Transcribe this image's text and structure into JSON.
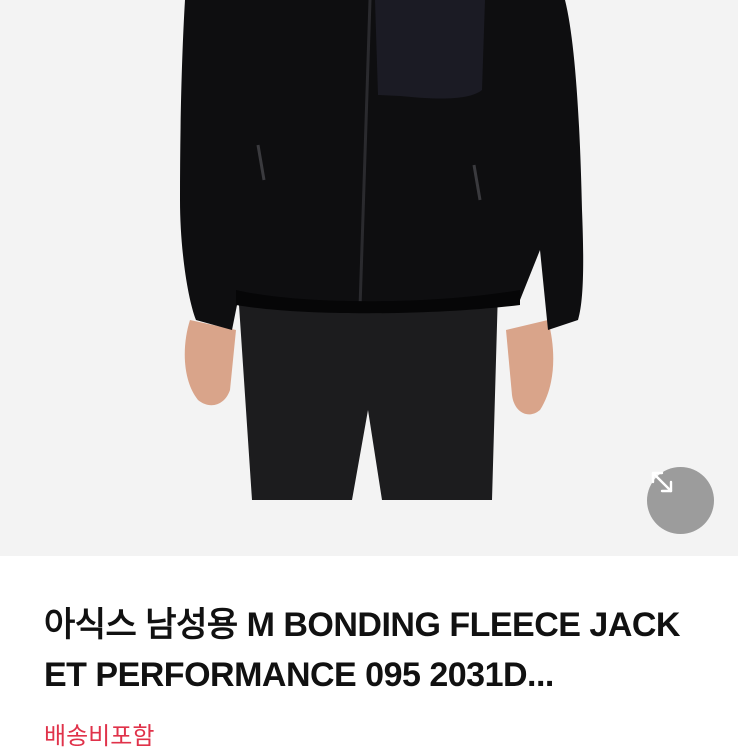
{
  "product": {
    "image_icon": "product-photo-fleece-jacket",
    "expand_icon": "expand-arrows-icon",
    "title": "아식스 남성용 M BONDING FLEECE JACKET PERFORMANCE 095 2031D...",
    "shipping_label": "배송비포함"
  },
  "colors": {
    "background": "#f3f3f3",
    "shipping_accent": "#e0324a",
    "title_text": "#111111"
  }
}
